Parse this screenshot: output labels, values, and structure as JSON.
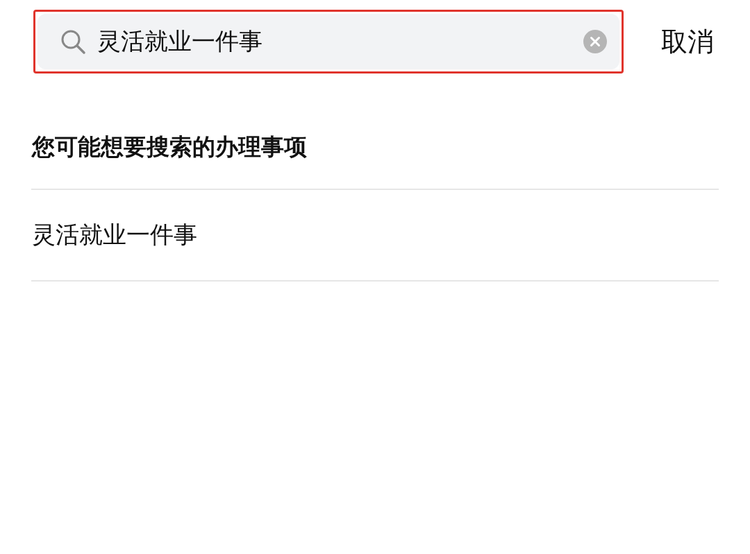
{
  "search": {
    "value": "灵活就业一件事",
    "highlighted": true
  },
  "cancel": "取消",
  "section_title": "您可能想要搜索的办理事项",
  "results": [
    {
      "label": "灵活就业一件事"
    }
  ]
}
